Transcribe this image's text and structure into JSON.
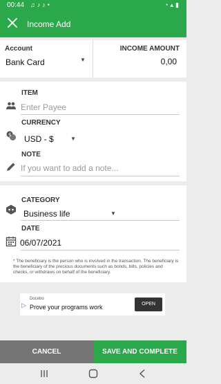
{
  "status_bar": {
    "time": "00:44"
  },
  "app_bar": {
    "title": "Income Add"
  },
  "account": {
    "label": "Account",
    "value": "Bank Card"
  },
  "amount": {
    "label": "INCOME AMOUNT",
    "value": "0,00"
  },
  "item": {
    "label": "ITEM",
    "placeholder": "Enter Payee"
  },
  "currency": {
    "label": "CURRENCY",
    "value": "USD - $"
  },
  "note": {
    "label": "NOTE",
    "placeholder": "If you want to add a note..."
  },
  "category": {
    "label": "CATEGORY",
    "value": "Business life"
  },
  "date": {
    "label": "DATE",
    "value": "06/07/2021"
  },
  "footnote": "* The beneficiary is the person who is involved in the transaction. The beneficiary is the beneficiary of the precious documents such as bonds, bills, policies and checks, or withdraws on behalf of the beneficiary.",
  "ad": {
    "brand": "Docebo",
    "headline": "Prove your programs work",
    "button": "OPEN"
  },
  "actions": {
    "cancel": "CANCEL",
    "save": "SAVE AND COMPLETE"
  },
  "colors": {
    "primary": "#2aa84a",
    "cancel": "#757575",
    "background": "#ececec"
  },
  "icons": [
    "close-icon",
    "people-icon",
    "currency-icon",
    "pencil-icon",
    "category-icon",
    "calendar-icon"
  ]
}
